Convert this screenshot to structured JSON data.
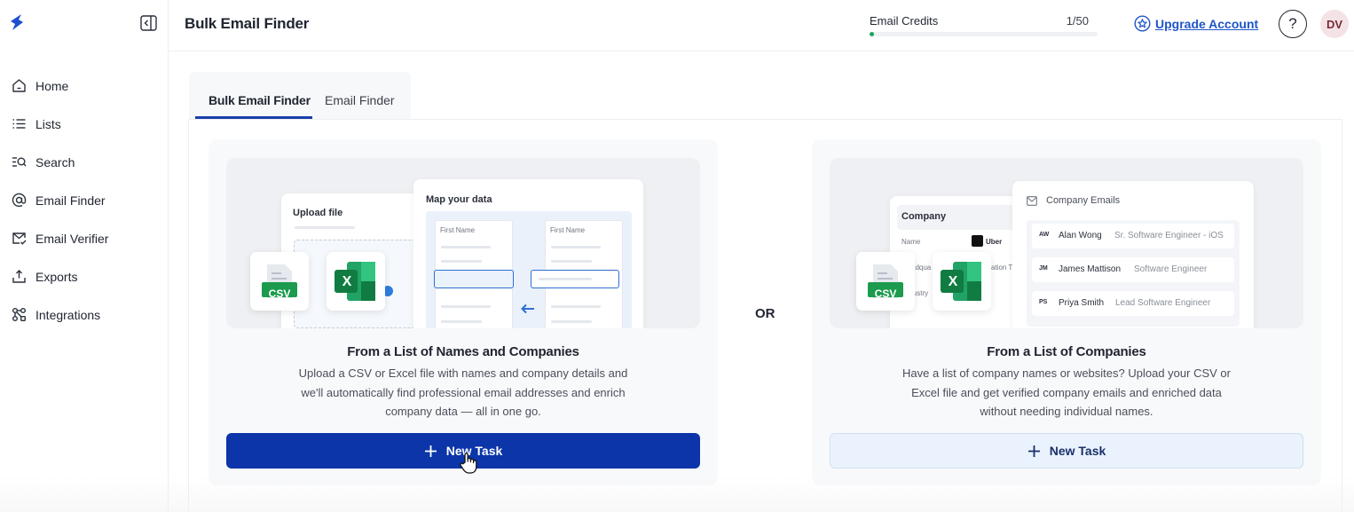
{
  "app": {
    "page_title": "Bulk Email Finder",
    "logo_icon": "lightning-s-logo",
    "brand_color": "#0b35a8"
  },
  "sidebar": {
    "items": [
      {
        "label": "Home",
        "icon": "home-icon"
      },
      {
        "label": "Lists",
        "icon": "list-icon"
      },
      {
        "label": "Search",
        "icon": "search-list-icon"
      },
      {
        "label": "Email Finder",
        "icon": "at-icon"
      },
      {
        "label": "Email Verifier",
        "icon": "mail-check-icon"
      },
      {
        "label": "Exports",
        "icon": "export-icon"
      },
      {
        "label": "Integrations",
        "icon": "integrations-icon"
      }
    ]
  },
  "header": {
    "credits_label": "Email Credits",
    "credits_count": "1/50",
    "credits_fraction": 0.02,
    "upgrade_label": "Upgrade Account",
    "help_label": "?",
    "avatar_initials": "DV"
  },
  "tabs": [
    {
      "label": "Bulk Email Finder",
      "active": true
    },
    {
      "label": "Email Finder",
      "active": false
    }
  ],
  "or_label": "OR",
  "cards": {
    "names": {
      "title": "From a List of Names and Companies",
      "description": "Upload a CSV or Excel file with names and company details and we'll automatically find professional email addresses and enrich company data — all in one go.",
      "button_label": "New Task",
      "illustration": {
        "upload_title": "Upload file",
        "map_title": "Map your data",
        "col1_header": "First Name",
        "col2_header": "First Name",
        "csv_label": "CSV",
        "excel_label": "X"
      }
    },
    "companies": {
      "title": "From a List of Companies",
      "description": "Have a list of company names or websites? Upload your CSV or Excel file and get verified company emails and enriched data without needing individual names.",
      "button_label": "New Task",
      "illustration": {
        "company_title": "Company",
        "name_label": "Name",
        "company_value": "Uber",
        "truncated_1": "adqua",
        "truncated_2": "ation T",
        "truncated_3": "lustry",
        "emails_title": "Company Emails",
        "contacts": [
          {
            "initials": "AW",
            "name": "Alan Wong",
            "role": "Sr. Software Engineer - iOS"
          },
          {
            "initials": "JM",
            "name": "James Mattison",
            "role": "Software Engineer"
          },
          {
            "initials": "PS",
            "name": "Priya Smith",
            "role": "Lead Software Engineer"
          }
        ],
        "csv_label": "CSV",
        "excel_label": "X"
      }
    }
  }
}
